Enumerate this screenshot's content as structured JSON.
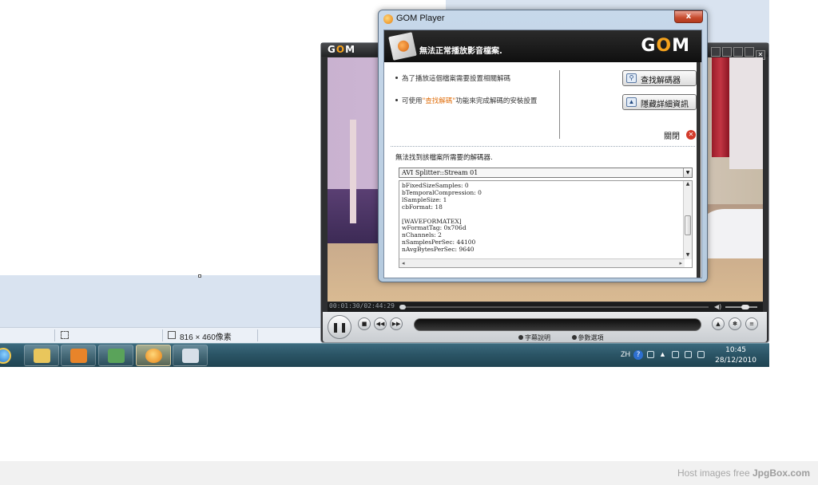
{
  "background_app": {
    "status_size": "816 × 460像素"
  },
  "taskbar": {
    "lang": "ZH",
    "help": "?",
    "time": "10:45",
    "date": "28/12/2010",
    "items": [
      {
        "icon": "ie-icon"
      },
      {
        "icon": "folder-icon",
        "color": "#e9c65c"
      },
      {
        "icon": "media-player-icon",
        "color": "#e8842a"
      },
      {
        "icon": "messenger-icon",
        "color": "#5aa35a"
      },
      {
        "icon": "gom-player-icon",
        "color": "#f09a20"
      },
      {
        "icon": "paint-icon",
        "color": "#d7dfe8"
      }
    ]
  },
  "gom_main": {
    "logo_pre": "G",
    "logo_o": "O",
    "logo_post": "M",
    "time": "00:01:30/02:44:29",
    "subtitle_label": "字幕說明",
    "options_label": "參數選項",
    "play_glyph": "❚❚"
  },
  "dialog": {
    "title": "GOM Player",
    "close_glyph": "x",
    "banner_text": "無法正常播放影音檔案.",
    "logo_pre": "G",
    "logo_o": "O",
    "logo_post": "M",
    "bullet1": "為了播放這個檔案需要設置相關解碼",
    "bullet2_pre": "可使用",
    "bullet2_hl": "\"查找解碼\"",
    "bullet2_post": "功能來完成解碼的安裝設置",
    "find_codec_button": "查找解碼器",
    "hide_details_button": "隱藏詳細資訊",
    "close_label": "關閉",
    "notice": "無法找到該檔案所需要的解碼器.",
    "select_value": "AVI Splitter::Stream 01",
    "details_text": "bFixedSizeSamples: 0\nbTemporalCompression: 0\nlSampleSize: 1\ncbFormat: 18\n\n[WAVEFORMATEX]\nwFormatTag: 0x706d\nnChannels: 2\nnSamplesPerSec: 44100\nnAvgBytesPerSec: 9640"
  },
  "footer": {
    "prefix": "Host images free ",
    "brand": "JpgBox.com"
  }
}
